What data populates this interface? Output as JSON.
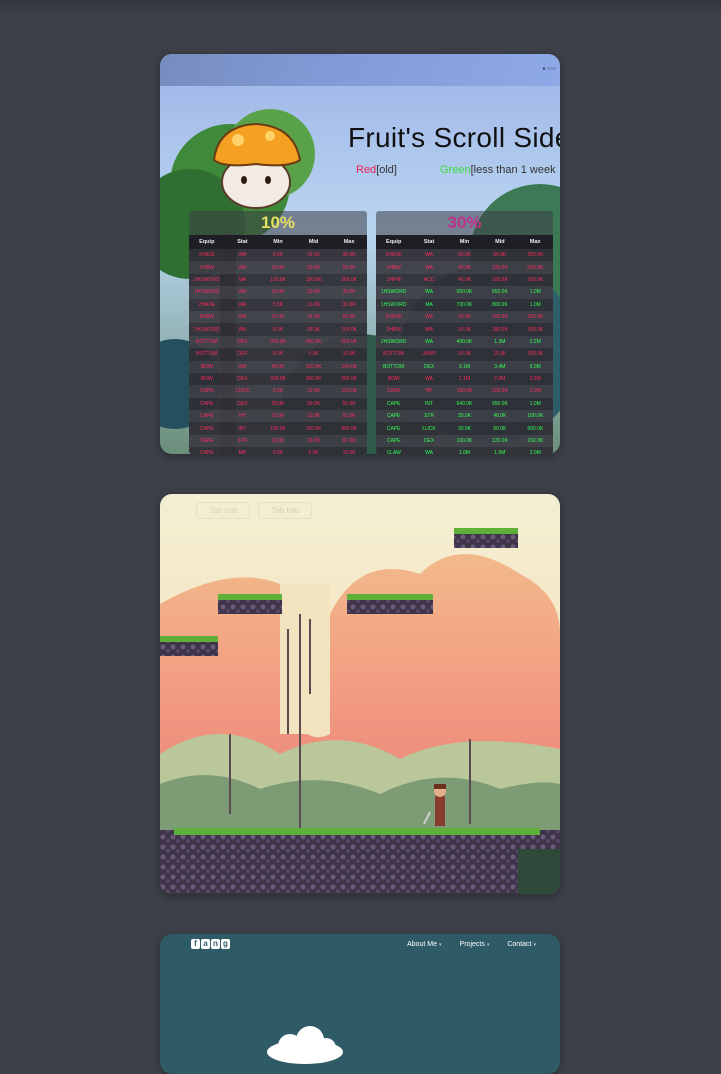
{
  "card1": {
    "corner_text": "● ○○○",
    "title": "Fruit's Scroll Side",
    "legend": {
      "red_word": "Red",
      "red_desc": "[old]",
      "green_word": "Green",
      "green_desc": "[less than 1 week"
    },
    "colors": {
      "red": "#ff2a5f",
      "green": "#33ff55",
      "title10": "#e8e060",
      "title30": "#c0308c"
    },
    "headers": [
      "Equip",
      "Stat",
      "Min",
      "Mid",
      "Max"
    ],
    "panel10": {
      "title": "10%",
      "rows": [
        {
          "c": "red",
          "v": [
            "1HAXE",
            "WA",
            "5.0K",
            "15.0K",
            "30.0K"
          ]
        },
        {
          "c": "red",
          "v": [
            "1HBW",
            "WA",
            "10.0K",
            "30.0K",
            "50.0K"
          ]
        },
        {
          "c": "red",
          "v": [
            "2HSWORD",
            "MA",
            "150.0K",
            "150.0K",
            "200.0K"
          ]
        },
        {
          "c": "red",
          "v": [
            "1HSWORD",
            "WA",
            "10.0K",
            "20.0K",
            "30.0K"
          ]
        },
        {
          "c": "red",
          "v": [
            "2HAXE",
            "WA",
            "5.0K",
            "10.0K",
            "30.0K"
          ]
        },
        {
          "c": "red",
          "v": [
            "2HBW",
            "WA",
            "10.0K",
            "15.0K",
            "50.0K"
          ]
        },
        {
          "c": "red",
          "v": [
            "2HSWORD",
            "WA",
            "5.0K",
            "30.0K",
            "100.0K"
          ]
        },
        {
          "c": "red",
          "v": [
            "BOTTOM",
            "DEX",
            "300.0K",
            "450.0K",
            "500.0K"
          ]
        },
        {
          "c": "red",
          "v": [
            "BOTTOM",
            "DEF",
            "5.0K",
            "5.0K",
            "10.0K"
          ]
        },
        {
          "c": "red",
          "v": [
            "BOW",
            "WA",
            "40.0K",
            "100.0K",
            "140.0K"
          ]
        },
        {
          "c": "red",
          "v": [
            "BOW",
            "DEX",
            "300.0K",
            "350.0K",
            "500.0K"
          ]
        },
        {
          "c": "red",
          "v": [
            "CAPE",
            "LUCK",
            "5.0K",
            "10.0K",
            "120.0K"
          ]
        },
        {
          "c": "red",
          "v": [
            "CAPE",
            "DEX",
            "20.0K",
            "30.0K",
            "50.0K"
          ]
        },
        {
          "c": "red",
          "v": [
            "CAPE",
            "HP",
            "10.0K",
            "10.0K",
            "50.0K"
          ]
        },
        {
          "c": "red",
          "v": [
            "CAPE",
            "INT",
            "100.0K",
            "150.0K",
            "400.0K"
          ]
        },
        {
          "c": "red",
          "v": [
            "CAPE",
            "STR",
            "10.0K",
            "30.0K",
            "60.0K"
          ]
        },
        {
          "c": "red",
          "v": [
            "CAPE",
            "MP",
            "5.0K",
            "5.0K",
            "10.0K"
          ]
        }
      ]
    },
    "panel30": {
      "title": "30%",
      "rows": [
        {
          "c": "red",
          "v": [
            "1HAXE",
            "WA",
            "50.0K",
            "55.0K",
            "250.0K"
          ]
        },
        {
          "c": "red",
          "v": [
            "1HBW",
            "WA",
            "40.0K",
            "230.0K",
            "500.0K"
          ]
        },
        {
          "c": "red",
          "v": [
            "1HPM",
            "ACC",
            "40.0K",
            "100.0K",
            "300.0K"
          ]
        },
        {
          "c": "green",
          "v": [
            "1HSWORD",
            "WA",
            "650.0K",
            "850.0K",
            "1.0M"
          ]
        },
        {
          "c": "green",
          "v": [
            "1HSWORD",
            "MA",
            "700.0K",
            "800.0K",
            "1.0M"
          ]
        },
        {
          "c": "red",
          "v": [
            "2HAXE",
            "WA",
            "15.0K",
            "150.0K",
            "300.0K"
          ]
        },
        {
          "c": "red",
          "v": [
            "2HBW",
            "WA",
            "10.0K",
            "180.0K",
            "250.0K"
          ]
        },
        {
          "c": "green",
          "v": [
            "2HSWORD",
            "WA",
            "400.0K",
            "1.2M",
            "2.2M"
          ]
        },
        {
          "c": "red",
          "v": [
            "BOTTOM",
            "JUMP",
            "10.0K",
            "15.0K",
            "200.0K"
          ]
        },
        {
          "c": "green",
          "v": [
            "BOTTOM",
            "DEX",
            "3.1M",
            "3.4M",
            "6.0M"
          ]
        },
        {
          "c": "red",
          "v": [
            "BOW",
            "WA",
            "1.1M",
            "2.0M",
            "3.2M"
          ]
        },
        {
          "c": "red",
          "v": [
            "CAPE",
            "HP",
            "150.0K",
            "200.0K",
            "1.0M"
          ]
        },
        {
          "c": "green",
          "v": [
            "CAPE",
            "INT",
            "640.0K",
            "950.0K",
            "1.0M"
          ]
        },
        {
          "c": "green",
          "v": [
            "CAPE",
            "STR",
            "30.0K",
            "40.0K",
            "100.0K"
          ]
        },
        {
          "c": "green",
          "v": [
            "CAPE",
            "LUCK",
            "30.0K",
            "50.0K",
            "600.0K"
          ]
        },
        {
          "c": "green",
          "v": [
            "CAPE",
            "DEX",
            "100.0K",
            "120.0K",
            "150.0K"
          ]
        },
        {
          "c": "green",
          "v": [
            "CLAW",
            "WA",
            "1.0M",
            "1.5M",
            "2.0M"
          ]
        }
      ]
    }
  },
  "card2": {
    "ghost_tabs": [
      "Tab one",
      "Tab two"
    ]
  },
  "card3": {
    "logo_letters": [
      "f",
      "a",
      "n",
      "g"
    ],
    "nav": [
      {
        "label": "About Me"
      },
      {
        "label": "Projects"
      },
      {
        "label": "Contact"
      }
    ]
  }
}
